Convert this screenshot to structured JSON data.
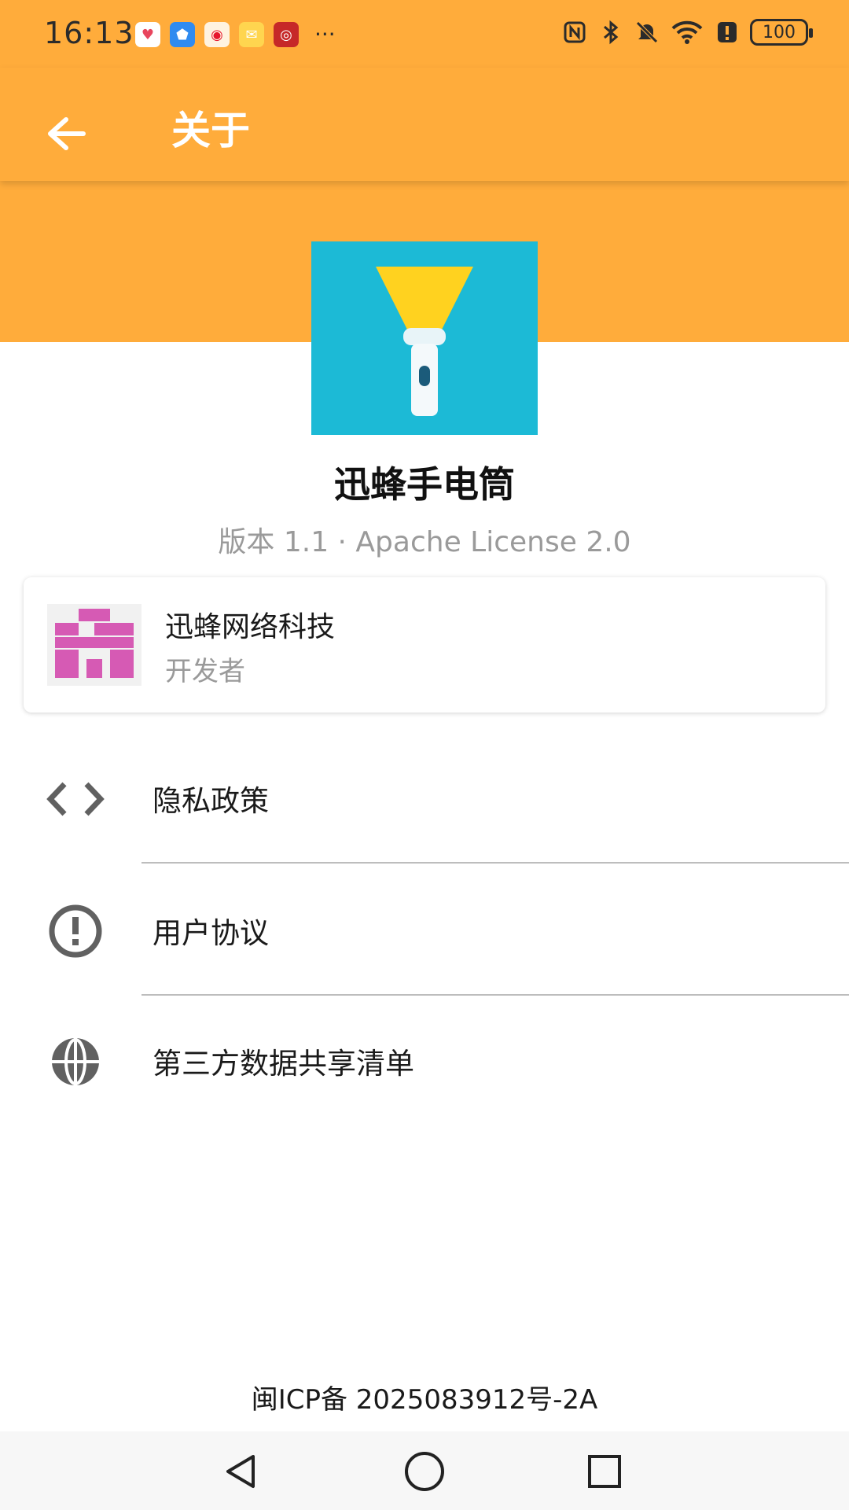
{
  "status_bar": {
    "time": "16:13",
    "notification_icons": [
      "health-icon",
      "shield-app-icon",
      "weibo-icon",
      "mail-icon",
      "video-app-icon"
    ],
    "more": "···",
    "system_icons": [
      "nfc-icon",
      "bluetooth-icon",
      "mute-icon",
      "wifi-icon",
      "alert-icon"
    ],
    "battery": "100"
  },
  "app_bar": {
    "back_icon": "arrow-left-icon",
    "title": "关于"
  },
  "app_info": {
    "name": "迅蜂手电筒",
    "version_line": "版本 1.1 · Apache License 2.0"
  },
  "developer": {
    "name": "迅蜂网络科技",
    "role": "开发者"
  },
  "menu": [
    {
      "icon": "code-icon",
      "label": "隐私政策"
    },
    {
      "icon": "info-icon",
      "label": "用户协议"
    },
    {
      "icon": "globe-icon",
      "label": "第三方数据共享清单"
    }
  ],
  "footer": {
    "icp": "闽ICP备 2025083912号-2A"
  },
  "colors": {
    "accent": "#FFAC3B",
    "icon_bg": "#1CBAD6",
    "avatar": "#D65AB4"
  },
  "nav": [
    "back-triangle-icon",
    "home-circle-icon",
    "recents-square-icon"
  ]
}
